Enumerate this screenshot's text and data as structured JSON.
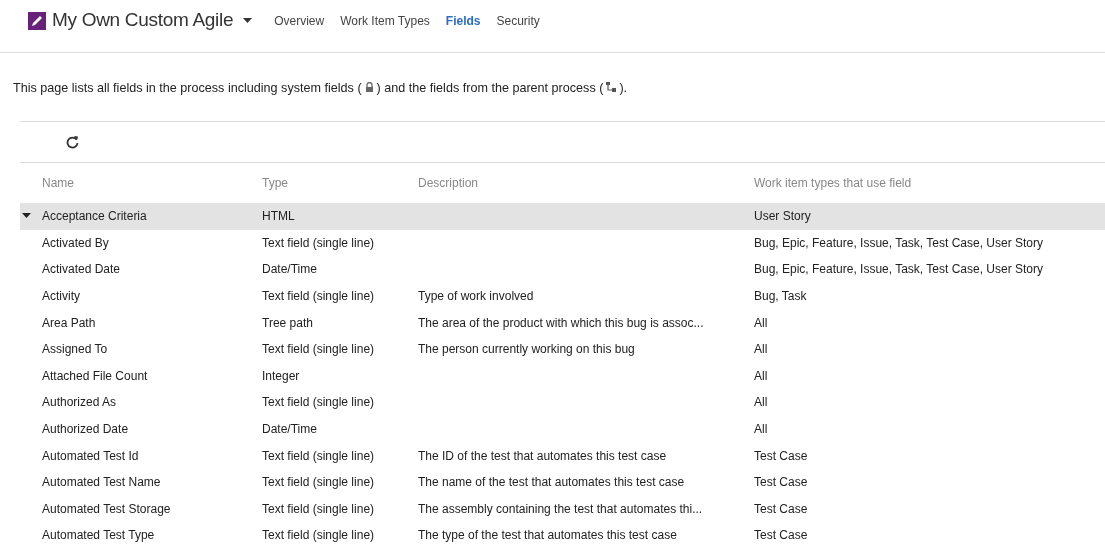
{
  "header": {
    "process_name": "My Own Custom Agile",
    "tabs": [
      {
        "label": "Overview",
        "selected": false
      },
      {
        "label": "Work Item Types",
        "selected": false
      },
      {
        "label": "Fields",
        "selected": true
      },
      {
        "label": "Security",
        "selected": false
      }
    ]
  },
  "intro": {
    "before_lock": "This page lists all fields in the process including system fields (",
    "between": ") and the fields from the parent process (",
    "after": ")."
  },
  "table": {
    "columns": [
      "Name",
      "Type",
      "Description",
      "Work item types that use field"
    ],
    "rows": [
      {
        "name": "Acceptance Criteria",
        "type": "HTML",
        "description": "",
        "work_item_types": "User Story",
        "selected": true
      },
      {
        "name": "Activated By",
        "type": "Text field (single line)",
        "description": "",
        "work_item_types": "Bug, Epic, Feature, Issue, Task, Test Case, User Story",
        "selected": false
      },
      {
        "name": "Activated Date",
        "type": "Date/Time",
        "description": "",
        "work_item_types": "Bug, Epic, Feature, Issue, Task, Test Case, User Story",
        "selected": false
      },
      {
        "name": "Activity",
        "type": "Text field (single line)",
        "description": "Type of work involved",
        "work_item_types": "Bug, Task",
        "selected": false
      },
      {
        "name": "Area Path",
        "type": "Tree path",
        "description": "The area of the product with which this bug is assoc...",
        "work_item_types": "All",
        "selected": false
      },
      {
        "name": "Assigned To",
        "type": "Text field (single line)",
        "description": "The person currently working on this bug",
        "work_item_types": "All",
        "selected": false
      },
      {
        "name": "Attached File Count",
        "type": "Integer",
        "description": "",
        "work_item_types": "All",
        "selected": false
      },
      {
        "name": "Authorized As",
        "type": "Text field (single line)",
        "description": "",
        "work_item_types": "All",
        "selected": false
      },
      {
        "name": "Authorized Date",
        "type": "Date/Time",
        "description": "",
        "work_item_types": "All",
        "selected": false
      },
      {
        "name": "Automated Test Id",
        "type": "Text field (single line)",
        "description": "The ID of the test that automates this test case",
        "work_item_types": "Test Case",
        "selected": false
      },
      {
        "name": "Automated Test Name",
        "type": "Text field (single line)",
        "description": "The name of the test that automates this test case",
        "work_item_types": "Test Case",
        "selected": false
      },
      {
        "name": "Automated Test Storage",
        "type": "Text field (single line)",
        "description": "The assembly containing the test that automates thi...",
        "work_item_types": "Test Case",
        "selected": false
      },
      {
        "name": "Automated Test Type",
        "type": "Text field (single line)",
        "description": "The type of the test that automates this test case",
        "work_item_types": "Test Case",
        "selected": false
      }
    ]
  }
}
